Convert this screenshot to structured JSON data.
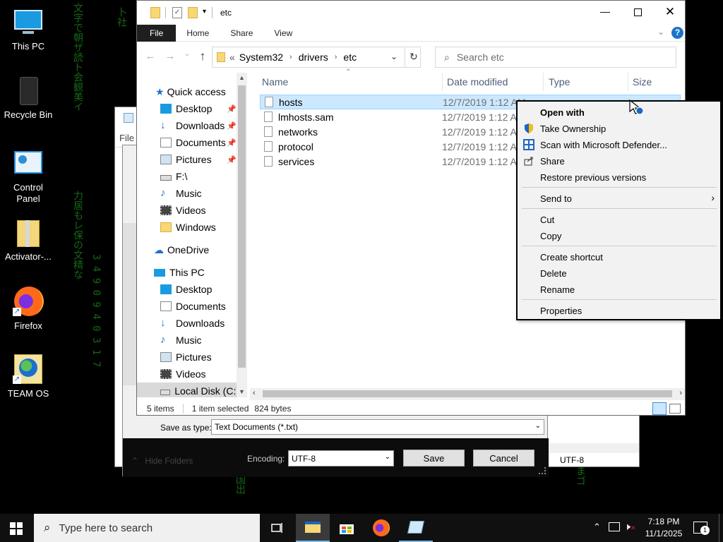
{
  "desktop": {
    "icons": [
      {
        "label": "This PC"
      },
      {
        "label": "Recycle Bin"
      },
      {
        "label": "Control\nPanel"
      },
      {
        "label": "Activator-..."
      },
      {
        "label": "Firefox"
      },
      {
        "label": "TEAM OS"
      }
    ]
  },
  "explorer": {
    "title": "etc",
    "ribbon_tabs": [
      "File",
      "Home",
      "Share",
      "View"
    ],
    "breadcrumb": [
      "«",
      "System32",
      "drivers",
      "etc"
    ],
    "search_placeholder": "Search etc",
    "nav": {
      "quick_access": "Quick access",
      "quick_items": [
        "Desktop",
        "Downloads",
        "Documents",
        "Pictures",
        "F:\\",
        "Music",
        "Videos",
        "Windows"
      ],
      "onedrive": "OneDrive",
      "this_pc": "This PC",
      "pc_items": [
        "Desktop",
        "Documents",
        "Downloads",
        "Music",
        "Pictures",
        "Videos",
        "Local Disk (C:)"
      ]
    },
    "columns": [
      "Name",
      "Date modified",
      "Type",
      "Size"
    ],
    "files": [
      {
        "name": "hosts",
        "date": "12/7/2019 1:12 AM"
      },
      {
        "name": "lmhosts.sam",
        "date": "12/7/2019 1:12 A"
      },
      {
        "name": "networks",
        "date": "12/7/2019 1:12 A"
      },
      {
        "name": "protocol",
        "date": "12/7/2019 1:12 A"
      },
      {
        "name": "services",
        "date": "12/7/2019 1:12 A"
      }
    ],
    "status": {
      "items": "5 items",
      "selected": "1 item selected",
      "size": "824 bytes"
    }
  },
  "context_menu": {
    "open_with": "Open with",
    "take_ownership": "Take Ownership",
    "scan": "Scan with Microsoft Defender...",
    "share": "Share",
    "restore": "Restore previous versions",
    "send_to": "Send to",
    "cut": "Cut",
    "copy": "Copy",
    "create_shortcut": "Create shortcut",
    "delete": "Delete",
    "rename": "Rename",
    "properties": "Properties"
  },
  "save_dialog": {
    "file_menu": "File",
    "save_as_type_label": "Save as type:",
    "save_as_type_value": "Text Documents (*.txt)",
    "hide_folders": "Hide Folders",
    "encoding_label": "Encoding:",
    "encoding_value": "UTF-8",
    "save": "Save",
    "cancel": "Cancel",
    "notepad_status_encoding": "UTF-8"
  },
  "taskbar": {
    "search_placeholder": "Type here to search",
    "time": "7:18 PM",
    "date": "11/1/2025",
    "notification_count": "1"
  },
  "colors": {
    "selection": "#cce8ff",
    "accent": "#0078d7",
    "folder": "#f8d775"
  }
}
